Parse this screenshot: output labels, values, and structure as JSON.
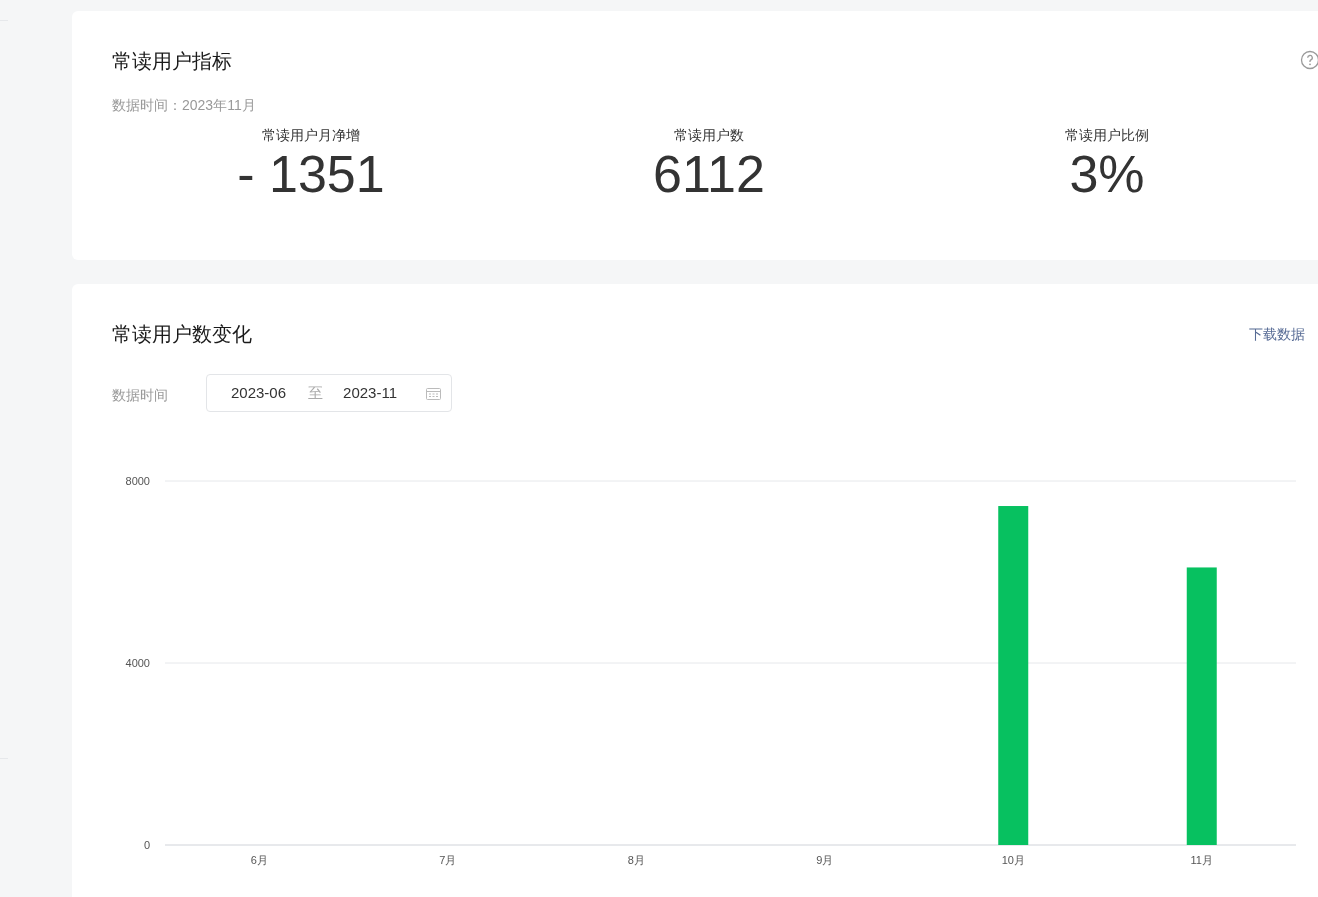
{
  "metrics_card": {
    "title": "常读用户指标",
    "data_time": "数据时间：2023年11月",
    "metrics": [
      {
        "label": "常读用户月净增",
        "value": "- 1351"
      },
      {
        "label": "常读用户数",
        "value": "6112"
      },
      {
        "label": "常读用户比例",
        "value": "3%"
      }
    ]
  },
  "trend_card": {
    "title": "常读用户数变化",
    "download_link": "下载数据",
    "date_filter": {
      "label": "数据时间",
      "start": "2023-06",
      "separator": "至",
      "end": "2023-11"
    },
    "chart_data": {
      "type": "bar",
      "categories": [
        "6月",
        "7月",
        "8月",
        "9月",
        "10月",
        "11月"
      ],
      "series": [
        {
          "color": "#07c160",
          "values": [
            0,
            0,
            0,
            0,
            7450,
            6100
          ]
        }
      ],
      "ylim": [
        0,
        8000
      ],
      "yticks": [
        0,
        4000,
        8000
      ]
    }
  }
}
